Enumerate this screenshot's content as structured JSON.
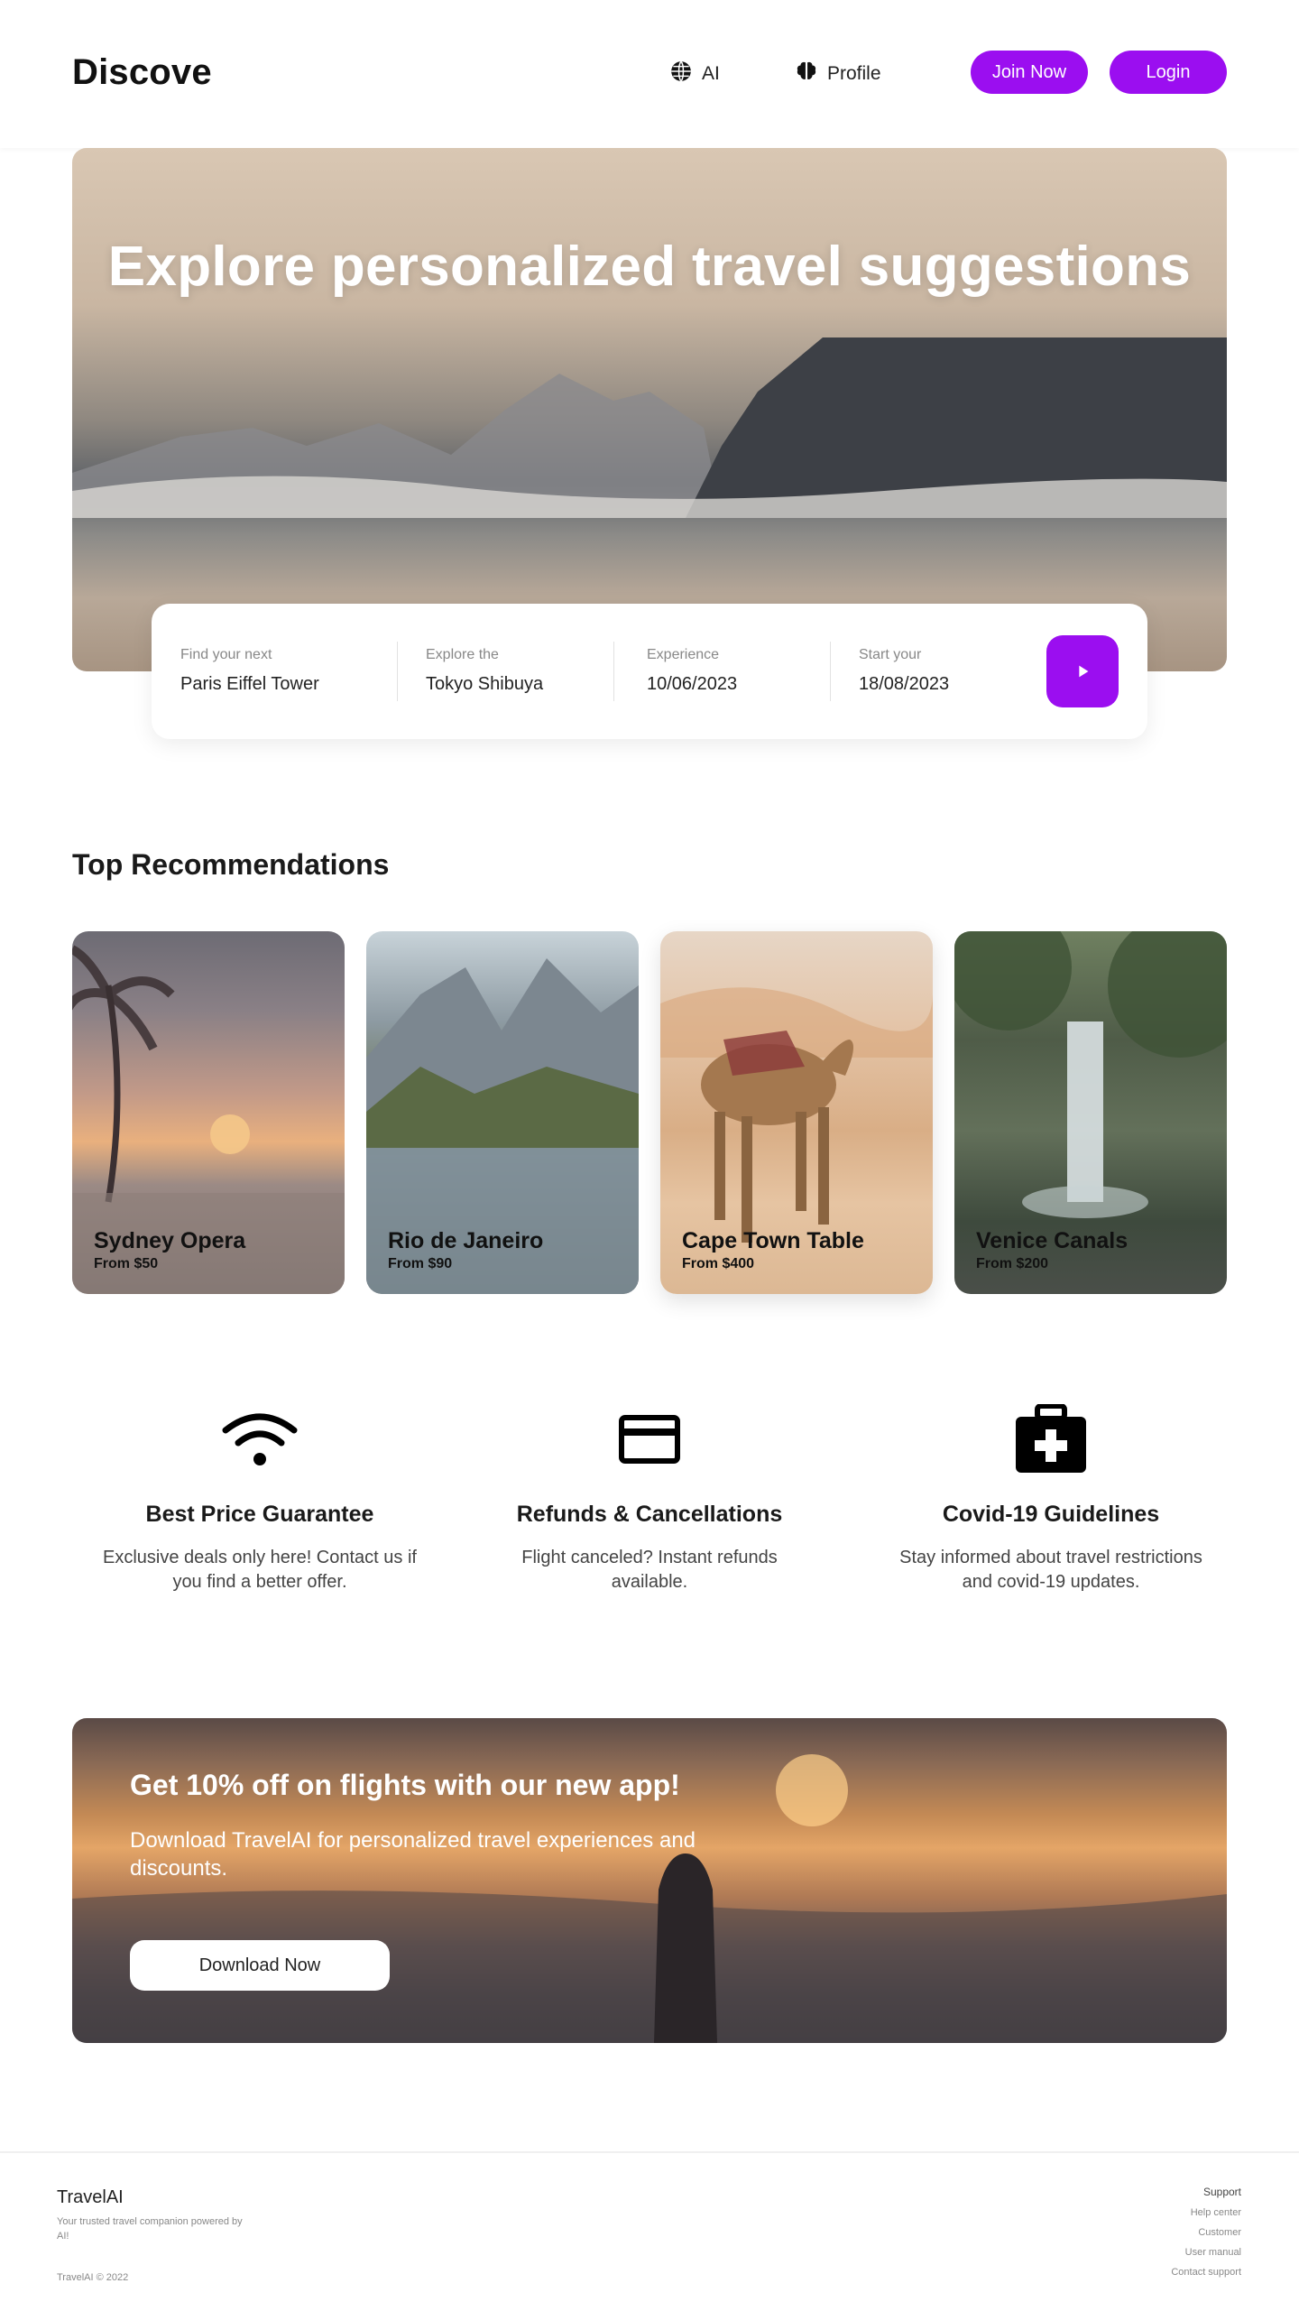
{
  "header": {
    "logo": "Discove",
    "nav": [
      {
        "label": "AI",
        "icon": "globe-icon"
      },
      {
        "label": "Profile",
        "icon": "brain-icon"
      }
    ],
    "join_label": "Join Now",
    "login_label": "Login"
  },
  "hero": {
    "title": "Explore personalized travel suggestions"
  },
  "search": {
    "fields": [
      {
        "label": "Find your next",
        "value": "Paris Eiffel Tower"
      },
      {
        "label": "Explore the",
        "value": "Tokyo Shibuya"
      },
      {
        "label": "Experience",
        "value": "10/06/2023"
      },
      {
        "label": "Start your",
        "value": "18/08/2023"
      }
    ],
    "submit_icon": "play-icon"
  },
  "recommendations": {
    "title": "Top Recommendations",
    "cards": [
      {
        "name": "Sydney Opera",
        "price": "From $50"
      },
      {
        "name": "Rio de Janeiro",
        "price": "From $90"
      },
      {
        "name": "Cape Town Table",
        "price": "From $400"
      },
      {
        "name": "Venice Canals",
        "price": "From $200"
      }
    ]
  },
  "features": [
    {
      "icon": "wifi-icon",
      "title": "Best Price Guarantee",
      "text": "Exclusive deals only here! Contact us if you find a better offer."
    },
    {
      "icon": "credit-card-icon",
      "title": "Refunds & Cancellations",
      "text": "Flight canceled? Instant refunds available."
    },
    {
      "icon": "medical-kit-icon",
      "title": "Covid-19 Guidelines",
      "text": "Stay informed about travel restrictions and covid-19 updates."
    }
  ],
  "promo": {
    "title": "Get 10% off on flights with our new app!",
    "subtitle": "Download TravelAI for personalized travel experiences and discounts.",
    "button": "Download Now"
  },
  "footer": {
    "brand": "TravelAI",
    "tagline": "Your trusted travel companion powered by AI!",
    "copyright": "TravelAI © 2022",
    "links_heading": "Support",
    "links": [
      "Help center",
      "Customer",
      "User manual",
      "Contact support"
    ]
  },
  "colors": {
    "accent": "#9b0ef0",
    "text": "#111111"
  }
}
